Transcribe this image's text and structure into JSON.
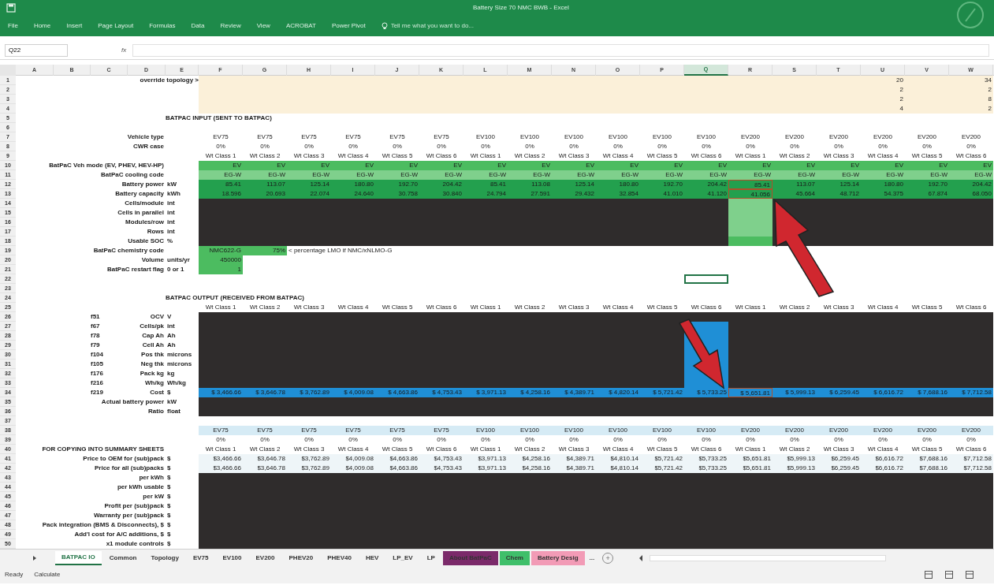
{
  "window": {
    "title": "Battery Size 70 NMC BWB - Excel"
  },
  "ribbon_tabs": [
    "File",
    "Home",
    "Insert",
    "Page Layout",
    "Formulas",
    "Data",
    "Review",
    "View",
    "ACROBAT",
    "Power Pivot"
  ],
  "tell_me": {
    "placeholder": "Tell me what you want to do..."
  },
  "name_box": "Q22",
  "formula_symbol": "fx",
  "columns": [
    {
      "letter": "A",
      "selected": false
    },
    {
      "letter": "B",
      "selected": false
    },
    {
      "letter": "C",
      "selected": false
    },
    {
      "letter": "D",
      "selected": false
    },
    {
      "letter": "E",
      "selected": false
    },
    {
      "letter": "F",
      "selected": false
    },
    {
      "letter": "G",
      "selected": false
    },
    {
      "letter": "H",
      "selected": false
    },
    {
      "letter": "I",
      "selected": false
    },
    {
      "letter": "J",
      "selected": false
    },
    {
      "letter": "K",
      "selected": false
    },
    {
      "letter": "L",
      "selected": false
    },
    {
      "letter": "M",
      "selected": false
    },
    {
      "letter": "N",
      "selected": false
    },
    {
      "letter": "O",
      "selected": false
    },
    {
      "letter": "P",
      "selected": false
    },
    {
      "letter": "Q",
      "selected": true
    },
    {
      "letter": "R",
      "selected": false
    },
    {
      "letter": "S",
      "selected": false
    },
    {
      "letter": "T",
      "selected": false
    },
    {
      "letter": "U",
      "selected": false
    },
    {
      "letter": "V",
      "selected": false
    },
    {
      "letter": "W",
      "selected": false
    }
  ],
  "rows": [
    {
      "number": "1",
      "override_label": "override topology >",
      "kind": "topology",
      "cells": {
        "U": {
          "text": "20"
        },
        "W": {
          "text": "34"
        }
      }
    },
    {
      "number": "2",
      "kind": "topology",
      "cells": {
        "U": {
          "text": "2"
        },
        "W": {
          "text": "2"
        }
      }
    },
    {
      "number": "3",
      "kind": "topology",
      "cells": {
        "U": {
          "text": "2"
        },
        "W": {
          "text": "8"
        }
      }
    },
    {
      "number": "4",
      "kind": "topology",
      "cells": {
        "U": {
          "text": "4"
        },
        "W": {
          "text": "2"
        }
      }
    },
    {
      "number": "5",
      "heading": "BATPAC INPUT (SENT TO BATPAC)"
    },
    {
      "number": "6"
    },
    {
      "number": "7",
      "label": "Vehicle type",
      "kind": "header",
      "values": [
        "EV75",
        "EV75",
        "EV75",
        "EV75",
        "EV75",
        "EV75",
        "EV100",
        "EV100",
        "EV100",
        "EV100",
        "EV100",
        "EV100",
        "EV200",
        "EV200",
        "EV200",
        "EV200",
        "EV200",
        "EV200"
      ]
    },
    {
      "number": "8",
      "label": "CWR case",
      "kind": "header",
      "values": [
        "0%",
        "0%",
        "0%",
        "0%",
        "0%",
        "0%",
        "0%",
        "0%",
        "0%",
        "0%",
        "0%",
        "0%",
        "0%",
        "0%",
        "0%",
        "0%",
        "0%",
        "0%"
      ]
    },
    {
      "number": "9",
      "kind": "header",
      "values": [
        "Wt Class 1",
        "Wt Class 2",
        "Wt Class 3",
        "Wt Class 4",
        "Wt Class 5",
        "Wt Class 6",
        "Wt Class 1",
        "Wt Class 2",
        "Wt Class 3",
        "Wt Class 4",
        "Wt Class 5",
        "Wt Class 6",
        "Wt Class 1",
        "Wt Class 2",
        "Wt Class 3",
        "Wt Class 4",
        "Wt Class 5",
        "Wt Class 6"
      ]
    },
    {
      "number": "10",
      "label": "BatPaC Veh mode (EV, PHEV, HEV-HP)",
      "kind": "mode",
      "values": [
        "EV",
        "EV",
        "EV",
        "EV",
        "EV",
        "EV",
        "EV",
        "EV",
        "EV",
        "EV",
        "EV",
        "EV",
        "EV",
        "EV",
        "EV",
        "EV",
        "EV",
        "EV"
      ]
    },
    {
      "number": "11",
      "label": "BatPaC cooling code",
      "kind": "cooling",
      "values": [
        "EG-W",
        "EG-W",
        "EG-W",
        "EG-W",
        "EG-W",
        "EG-W",
        "EG-W",
        "EG-W",
        "EG-W",
        "EG-W",
        "EG-W",
        "EG-W",
        "EG-W",
        "EG-W",
        "EG-W",
        "EG-W",
        "EG-W",
        "EG-W"
      ]
    },
    {
      "number": "12",
      "label": "Battery power",
      "unit": "kW",
      "kind": "metric",
      "outlined": {
        "R": true
      },
      "values": [
        "85.41",
        "113.07",
        "125.14",
        "180.80",
        "192.70",
        "204.42",
        "85.41",
        "113.08",
        "125.14",
        "180.80",
        "192.70",
        "204.42",
        "85.41",
        "113.07",
        "125.14",
        "180.80",
        "192.70",
        "204.42"
      ]
    },
    {
      "number": "13",
      "label": "Battery capacity",
      "unit": "kWh",
      "kind": "metric",
      "outlined": {
        "R": true
      },
      "values": [
        "18.596",
        "20.693",
        "22.074",
        "24.640",
        "30.758",
        "30.840",
        "24.794",
        "27.591",
        "29.432",
        "32.854",
        "41.010",
        "41.120",
        "41.056",
        "45.664",
        "48.712",
        "54.375",
        "67.874",
        "68.050"
      ]
    },
    {
      "number": "14",
      "label": "Cells/module",
      "unit": "int",
      "kind": "blocked",
      "cells": {
        "R": {
          "kind": "pale"
        }
      }
    },
    {
      "number": "15",
      "label": "Cells in parallel",
      "unit": "int",
      "kind": "blocked",
      "cells": {
        "R": {
          "kind": "pale"
        }
      }
    },
    {
      "number": "16",
      "label": "Modules/row",
      "unit": "int",
      "kind": "blocked",
      "cells": {
        "R": {
          "kind": "pale"
        }
      }
    },
    {
      "number": "17",
      "label": "Rows",
      "unit": "int",
      "kind": "blocked",
      "cells": {
        "R": {
          "kind": "pale"
        }
      }
    },
    {
      "number": "18",
      "label": "Usable SOC",
      "unit": "%",
      "kind": "blocked",
      "cells": {
        "R": {
          "kind": "input"
        }
      }
    },
    {
      "number": "19",
      "label": "BatPaC chemistry code",
      "cells": {
        "F": {
          "text": "NMC622-G",
          "kind": "input"
        },
        "G": {
          "text": "75%",
          "kind": "input"
        },
        "H": {
          "text": "< percentage LMO if NMC/xNLMO-G",
          "kind": "note"
        }
      }
    },
    {
      "number": "20",
      "label": "Volume",
      "unit": "units/yr",
      "cells": {
        "F": {
          "text": "450000",
          "kind": "input"
        }
      }
    },
    {
      "number": "21",
      "label": "BatPaC restart flag",
      "unit": "0 or 1",
      "cells": {
        "F": {
          "text": "1",
          "kind": "input"
        }
      }
    },
    {
      "number": "22",
      "cells": {
        "Q": {
          "selected": true
        }
      }
    },
    {
      "number": "23"
    },
    {
      "number": "24",
      "heading": "BATPAC OUTPUT (RECEIVED FROM BATPAC)"
    },
    {
      "number": "25",
      "kind": "header",
      "values": [
        "Wt Class 1",
        "Wt Class 2",
        "Wt Class 3",
        "Wt Class 4",
        "Wt Class 5",
        "Wt Class 6",
        "Wt Class 1",
        "Wt Class 2",
        "Wt Class 3",
        "Wt Class 4",
        "Wt Class 5",
        "Wt Class 6",
        "Wt Class 1",
        "Wt Class 2",
        "Wt Class 3",
        "Wt Class 4",
        "Wt Class 5",
        "Wt Class 6"
      ]
    },
    {
      "number": "26",
      "code": "f51",
      "label": "OCV",
      "unit": "V",
      "kind": "blocked"
    },
    {
      "number": "27",
      "code": "f67",
      "label": "Cells/pk",
      "unit": "int",
      "kind": "blocked",
      "cells": {
        "Q": {
          "kind": "output"
        }
      }
    },
    {
      "number": "28",
      "code": "f78",
      "label": "Cap Ah",
      "unit": "Ah",
      "kind": "blocked",
      "cells": {
        "Q": {
          "kind": "output"
        }
      }
    },
    {
      "number": "29",
      "code": "f79",
      "label": "Cell Ah",
      "unit": "Ah",
      "kind": "blocked",
      "cells": {
        "Q": {
          "kind": "output"
        }
      }
    },
    {
      "number": "30",
      "code": "f104",
      "label": "Pos thk",
      "unit": "microns",
      "kind": "blocked",
      "cells": {
        "Q": {
          "kind": "output"
        }
      }
    },
    {
      "number": "31",
      "code": "f105",
      "label": "Neg thk",
      "unit": "microns",
      "kind": "blocked",
      "cells": {
        "Q": {
          "kind": "output"
        }
      }
    },
    {
      "number": "32",
      "code": "f176",
      "label": "Pack kg",
      "unit": "kg",
      "kind": "blocked",
      "cells": {
        "Q": {
          "kind": "output"
        }
      }
    },
    {
      "number": "33",
      "code": "f216",
      "label": "Wh/kg",
      "unit": "Wh/kg",
      "kind": "blocked",
      "cells": {
        "Q": {
          "kind": "output"
        }
      }
    },
    {
      "number": "34",
      "code": "f219",
      "label": "Cost",
      "unit": "$",
      "kind": "cost",
      "outlined": {
        "R": true
      },
      "values": [
        "$ 3,466.66",
        "$ 3,646.78",
        "$ 3,762.89",
        "$ 4,009.08",
        "$ 4,663.86",
        "$ 4,753.43",
        "$ 3,971.13",
        "$ 4,258.16",
        "$ 4,389.71",
        "$ 4,820.14",
        "$ 5,721.42",
        "$ 5,733.25",
        "$ 5,651.81",
        "$ 5,999.13",
        "$ 6,259.45",
        "$ 6,616.72",
        "$ 7,688.16",
        "$ 7,712.58"
      ]
    },
    {
      "number": "35",
      "label": "Actual battery power",
      "unit": "kW",
      "kind": "blocked"
    },
    {
      "number": "36",
      "label": "Ratio",
      "unit": "float",
      "kind": "blocked"
    },
    {
      "number": "37"
    },
    {
      "number": "38",
      "kind": "type-band",
      "values": [
        "EV75",
        "EV75",
        "EV75",
        "EV75",
        "EV75",
        "EV75",
        "EV100",
        "EV100",
        "EV100",
        "EV100",
        "EV100",
        "EV100",
        "EV200",
        "EV200",
        "EV200",
        "EV200",
        "EV200",
        "EV200"
      ]
    },
    {
      "number": "39",
      "kind": "header",
      "values": [
        "0%",
        "0%",
        "0%",
        "0%",
        "0%",
        "0%",
        "0%",
        "0%",
        "0%",
        "0%",
        "0%",
        "0%",
        "0%",
        "0%",
        "0%",
        "0%",
        "0%",
        "0%"
      ]
    },
    {
      "number": "40",
      "label": "FOR COPYING INTO SUMMARY SHEETS",
      "kind": "header",
      "values": [
        "Wt Class 1",
        "Wt Class 2",
        "Wt Class 3",
        "Wt Class 4",
        "Wt Class 5",
        "Wt Class 6",
        "Wt Class 1",
        "Wt Class 2",
        "Wt Class 3",
        "Wt Class 4",
        "Wt Class 5",
        "Wt Class 6",
        "Wt Class 1",
        "Wt Class 2",
        "Wt Class 3",
        "Wt Class 4",
        "Wt Class 5",
        "Wt Class 6"
      ]
    },
    {
      "number": "41",
      "label": "Price to OEM for (sub)pack",
      "unit": "$",
      "kind": "price",
      "values": [
        "$3,466.66",
        "$3,646.78",
        "$3,762.89",
        "$4,009.08",
        "$4,663.86",
        "$4,753.43",
        "$3,971.13",
        "$4,258.16",
        "$4,389.71",
        "$4,810.14",
        "$5,721.42",
        "$5,733.25",
        "$5,651.81",
        "$5,999.13",
        "$6,259.45",
        "$6,616.72",
        "$7,688.16",
        "$7,712.58"
      ]
    },
    {
      "number": "42",
      "label": "Price for all (sub)packs",
      "unit": "$",
      "kind": "price",
      "values": [
        "$3,466.66",
        "$3,646.78",
        "$3,762.89",
        "$4,009.08",
        "$4,663.86",
        "$4,753.43",
        "$3,971.13",
        "$4,258.16",
        "$4,389.71",
        "$4,810.14",
        "$5,721.42",
        "$5,733.25",
        "$5,651.81",
        "$5,999.13",
        "$6,259.45",
        "$6,616.72",
        "$7,688.16",
        "$7,712.58"
      ]
    },
    {
      "number": "43",
      "label": "per kWh",
      "unit": "$",
      "kind": "blocked"
    },
    {
      "number": "44",
      "label": "per kWh usable",
      "unit": "$",
      "kind": "blocked"
    },
    {
      "number": "45",
      "label": "per kW",
      "unit": "$",
      "kind": "blocked"
    },
    {
      "number": "46",
      "label": "Profit per (sub)pack",
      "unit": "$",
      "kind": "blocked"
    },
    {
      "number": "47",
      "label": "Warranty per (sub)pack",
      "unit": "$",
      "kind": "blocked"
    },
    {
      "number": "48",
      "label": "Pack integration (BMS & Disconnects), $",
      "unit": "$",
      "kind": "blocked"
    },
    {
      "number": "49",
      "label": "Add'l cost for A/C additions, $",
      "unit": "$",
      "kind": "blocked"
    },
    {
      "number": "50",
      "label": "x1 module controls",
      "unit": "$",
      "kind": "blocked"
    }
  ],
  "sheet_tabs": [
    {
      "label": "BATPAC IO",
      "selected": true
    },
    {
      "label": "Common",
      "selected": false
    },
    {
      "label": "Topology",
      "selected": false
    },
    {
      "label": "EV75",
      "selected": false
    },
    {
      "label": "EV100",
      "selected": false
    },
    {
      "label": "EV200",
      "selected": false
    },
    {
      "label": "PHEV20",
      "selected": false
    },
    {
      "label": "PHEV40",
      "selected": false
    },
    {
      "label": "HEV",
      "selected": false
    },
    {
      "label": "LP_EV",
      "selected": false
    },
    {
      "label": "LP",
      "selected": false
    },
    {
      "label": "About BatPaC",
      "selected": false,
      "color": "#7b2a6a"
    },
    {
      "label": "Chem",
      "selected": false,
      "color": "#3fbf6a"
    },
    {
      "label": "Battery Desig",
      "selected": false,
      "color": "#f29bb6"
    }
  ],
  "more_tabs": "...",
  "add_sheet": "+",
  "status_bar": [
    "Ready",
    "Calculate"
  ]
}
